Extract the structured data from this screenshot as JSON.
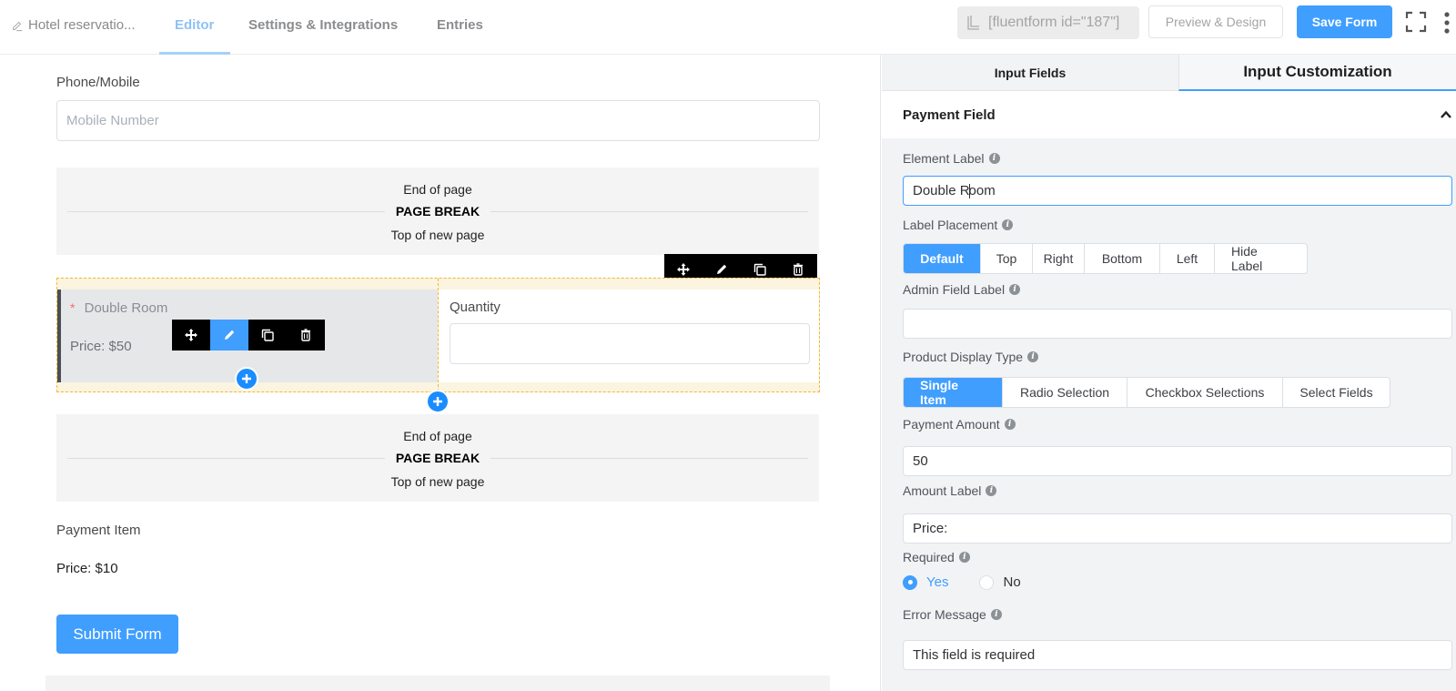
{
  "header": {
    "form_title": "Hotel reservatio...",
    "tabs": [
      {
        "label": "Editor",
        "active": true
      },
      {
        "label": "Settings & Integrations",
        "active": false
      },
      {
        "label": "Entries",
        "active": false
      }
    ],
    "shortcode": "[fluentform id=\"187\"]",
    "preview_label": "Preview & Design",
    "save_label": "Save Form"
  },
  "canvas": {
    "phone": {
      "label": "Phone/Mobile",
      "placeholder": "Mobile Number"
    },
    "page_break_1": {
      "top": "End of page",
      "middle": "PAGE BREAK",
      "bottom": "Top of new page"
    },
    "payment_field": {
      "required_mark": "*",
      "label": "Double Room",
      "price": "Price: $50"
    },
    "quantity": {
      "label": "Quantity",
      "value": ""
    },
    "page_break_2": {
      "top": "End of page",
      "middle": "PAGE BREAK",
      "bottom": "Top of new page"
    },
    "payment_item": {
      "label": "Payment Item",
      "price": "Price: $10"
    },
    "submit_label": "Submit Form"
  },
  "panel": {
    "tabs": [
      {
        "label": "Input Fields",
        "active": false
      },
      {
        "label": "Input Customization",
        "active": true
      }
    ],
    "section_title": "Payment Field",
    "element_label": {
      "label": "Element Label",
      "value_before_caret": "Double R",
      "value_after_caret": "oom"
    },
    "label_placement": {
      "label": "Label Placement",
      "options": [
        "Default",
        "Top",
        "Right",
        "Bottom",
        "Left",
        "Hide Label"
      ],
      "selected": "Default"
    },
    "admin_field_label": {
      "label": "Admin Field Label",
      "value": ""
    },
    "product_display_type": {
      "label": "Product Display Type",
      "options": [
        "Single Item",
        "Radio Selection",
        "Checkbox Selections",
        "Select Fields"
      ],
      "selected": "Single Item"
    },
    "payment_amount": {
      "label": "Payment Amount",
      "value": "50"
    },
    "amount_label": {
      "label": "Amount Label",
      "value": "Price:"
    },
    "required": {
      "label": "Required",
      "yes": "Yes",
      "no": "No",
      "selected": "Yes"
    },
    "error_message": {
      "label": "Error Message",
      "value": "This field is required"
    }
  },
  "colors": {
    "accent": "#409eff",
    "required": "#f56c6c",
    "container_border": "#f5b82e"
  }
}
